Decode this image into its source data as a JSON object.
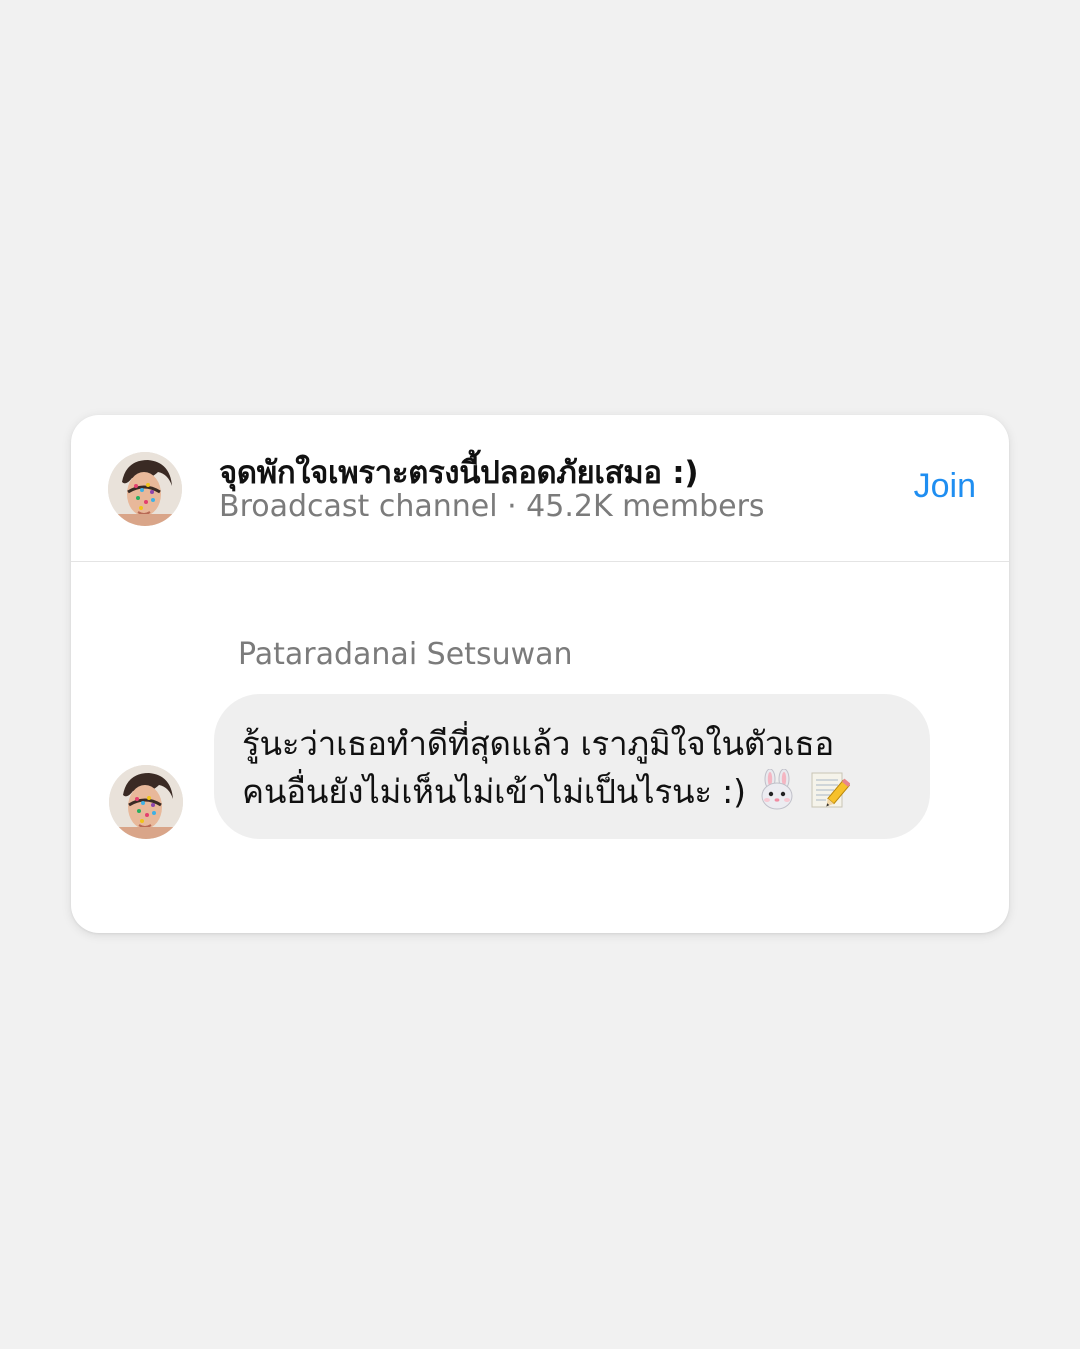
{
  "channel": {
    "title": "จุดพักใจเพราะตรงนี้ปลอดภัยเสมอ :)",
    "meta": "Broadcast channel · 45.2K members",
    "join_label": "Join"
  },
  "message": {
    "sender": "Pataradanai Setsuwan",
    "line1": "รู้นะว่าเธอทำดีที่สุดแล้ว เราภูมิใจในตัวเธอ",
    "line2": "คนอื่นยังไม่เห็นไม่เข้าไม่เป็นไรนะ :)",
    "emojis": [
      "rabbit-face-emoji",
      "memo-emoji"
    ]
  },
  "colors": {
    "background": "#f1f1f1",
    "card": "#ffffff",
    "bubble": "#efefef",
    "accent": "#1f8ef1",
    "secondary_text": "#7b7b7b"
  }
}
